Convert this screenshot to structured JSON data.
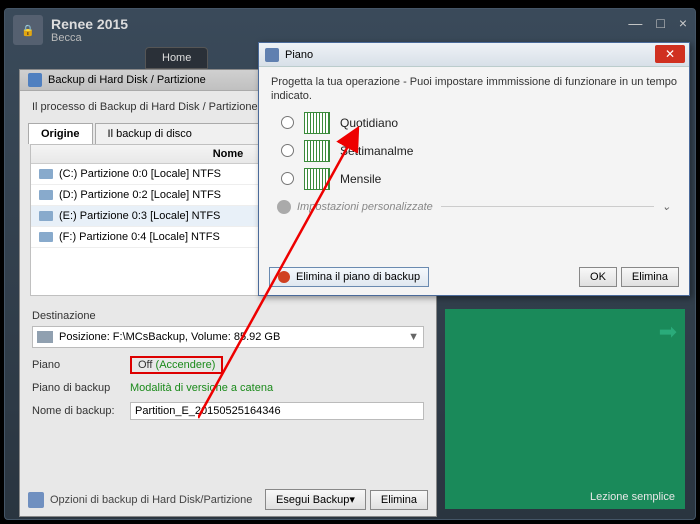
{
  "app": {
    "title": "Renee 2015",
    "subtitle": "Becca",
    "home": "Home"
  },
  "win_controls": {
    "min": "—",
    "max": "□",
    "close": "×"
  },
  "panel": {
    "title": "Backup di Hard Disk / Partizione",
    "process": "Il processo di Backup di Hard Disk / Partizione",
    "tab_origin": "Origine",
    "tab_disco": "Il backup di disco",
    "col_name": "Nome",
    "rows": [
      "(C:) Partizione 0:0 [Locale]  NTFS",
      "(D:) Partizione 0:2 [Locale]  NTFS",
      "(E:) Partizione 0:3 [Locale]  NTFS",
      "(F:) Partizione 0:4 [Locale]  NTFS"
    ],
    "dest_label": "Destinazione",
    "dest_value": "Posizione: F:\\MCsBackup, Volume: 85.92 GB",
    "piano_label": "Piano",
    "piano_off": "Off",
    "piano_acc": "(Accendere)",
    "piano_backup_label": "Piano di backup",
    "modalita": "Modalità di versione a catena",
    "nome_label": "Nome di backup:",
    "nome_value": "Partition_E_20150525164346",
    "options": "Opzioni di backup di Hard Disk/Partizione",
    "btn_backup": "Esegui Backup▾",
    "btn_elimina": "Elimina"
  },
  "green": {
    "lezione": "Lezione semplice"
  },
  "dialog": {
    "title": "Piano",
    "desc": "Progetta la tua operazione - Puoi impostare immmissione di funzionare in un tempo indicato.",
    "opt1": "Quotidiano",
    "opt2": "Settimanalme",
    "opt3": "Mensile",
    "pers": "Impostazioni personalizzate",
    "elim": "Elimina il piano di backup",
    "ok": "OK",
    "del": "Elimina"
  }
}
